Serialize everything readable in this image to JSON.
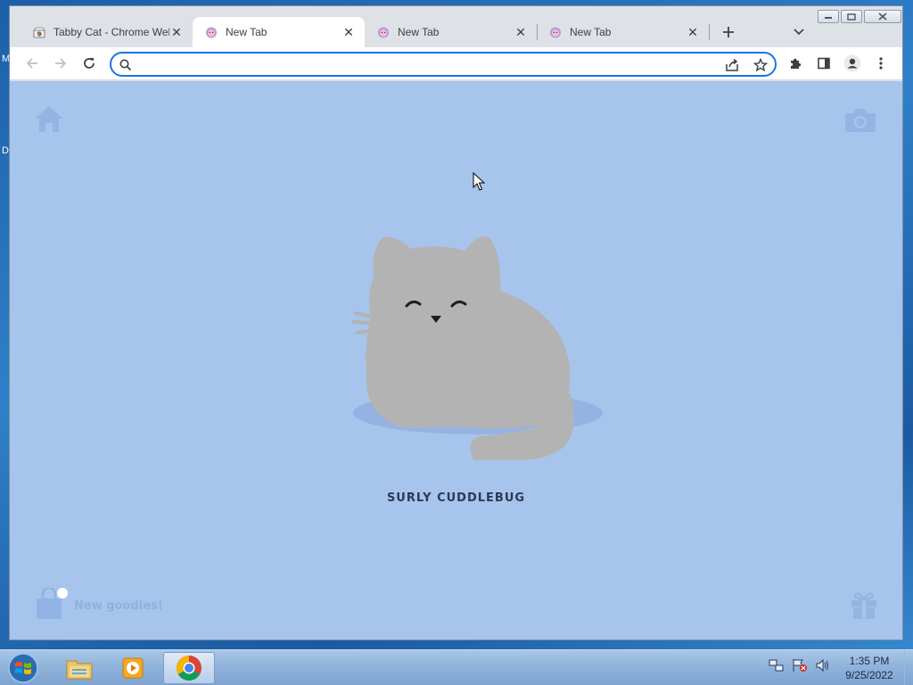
{
  "desktop": {
    "edge_letters": [
      "M",
      "D"
    ]
  },
  "browser": {
    "tabs": [
      {
        "title": "Tabby Cat - Chrome Web Store",
        "icon": "chrome-web-store-icon",
        "active": false
      },
      {
        "title": "New Tab",
        "icon": "tabby-cat-icon",
        "active": true
      },
      {
        "title": "New Tab",
        "icon": "tabby-cat-icon",
        "active": false
      },
      {
        "title": "New Tab",
        "icon": "tabby-cat-icon",
        "active": false
      }
    ],
    "omnibox": {
      "value": "",
      "placeholder": ""
    },
    "colors": {
      "accent": "#1a73e8",
      "page_background": "#a7c4ec",
      "cat": "#b3b3b3"
    }
  },
  "page": {
    "cat_name": "SURLY CUDDLEBUG",
    "goodies_label": "New goodies!"
  },
  "taskbar": {
    "apps": [
      "windows-explorer-icon",
      "media-player-icon",
      "chrome-icon"
    ],
    "clock": {
      "time": "1:35 PM",
      "date": "9/25/2022"
    }
  }
}
